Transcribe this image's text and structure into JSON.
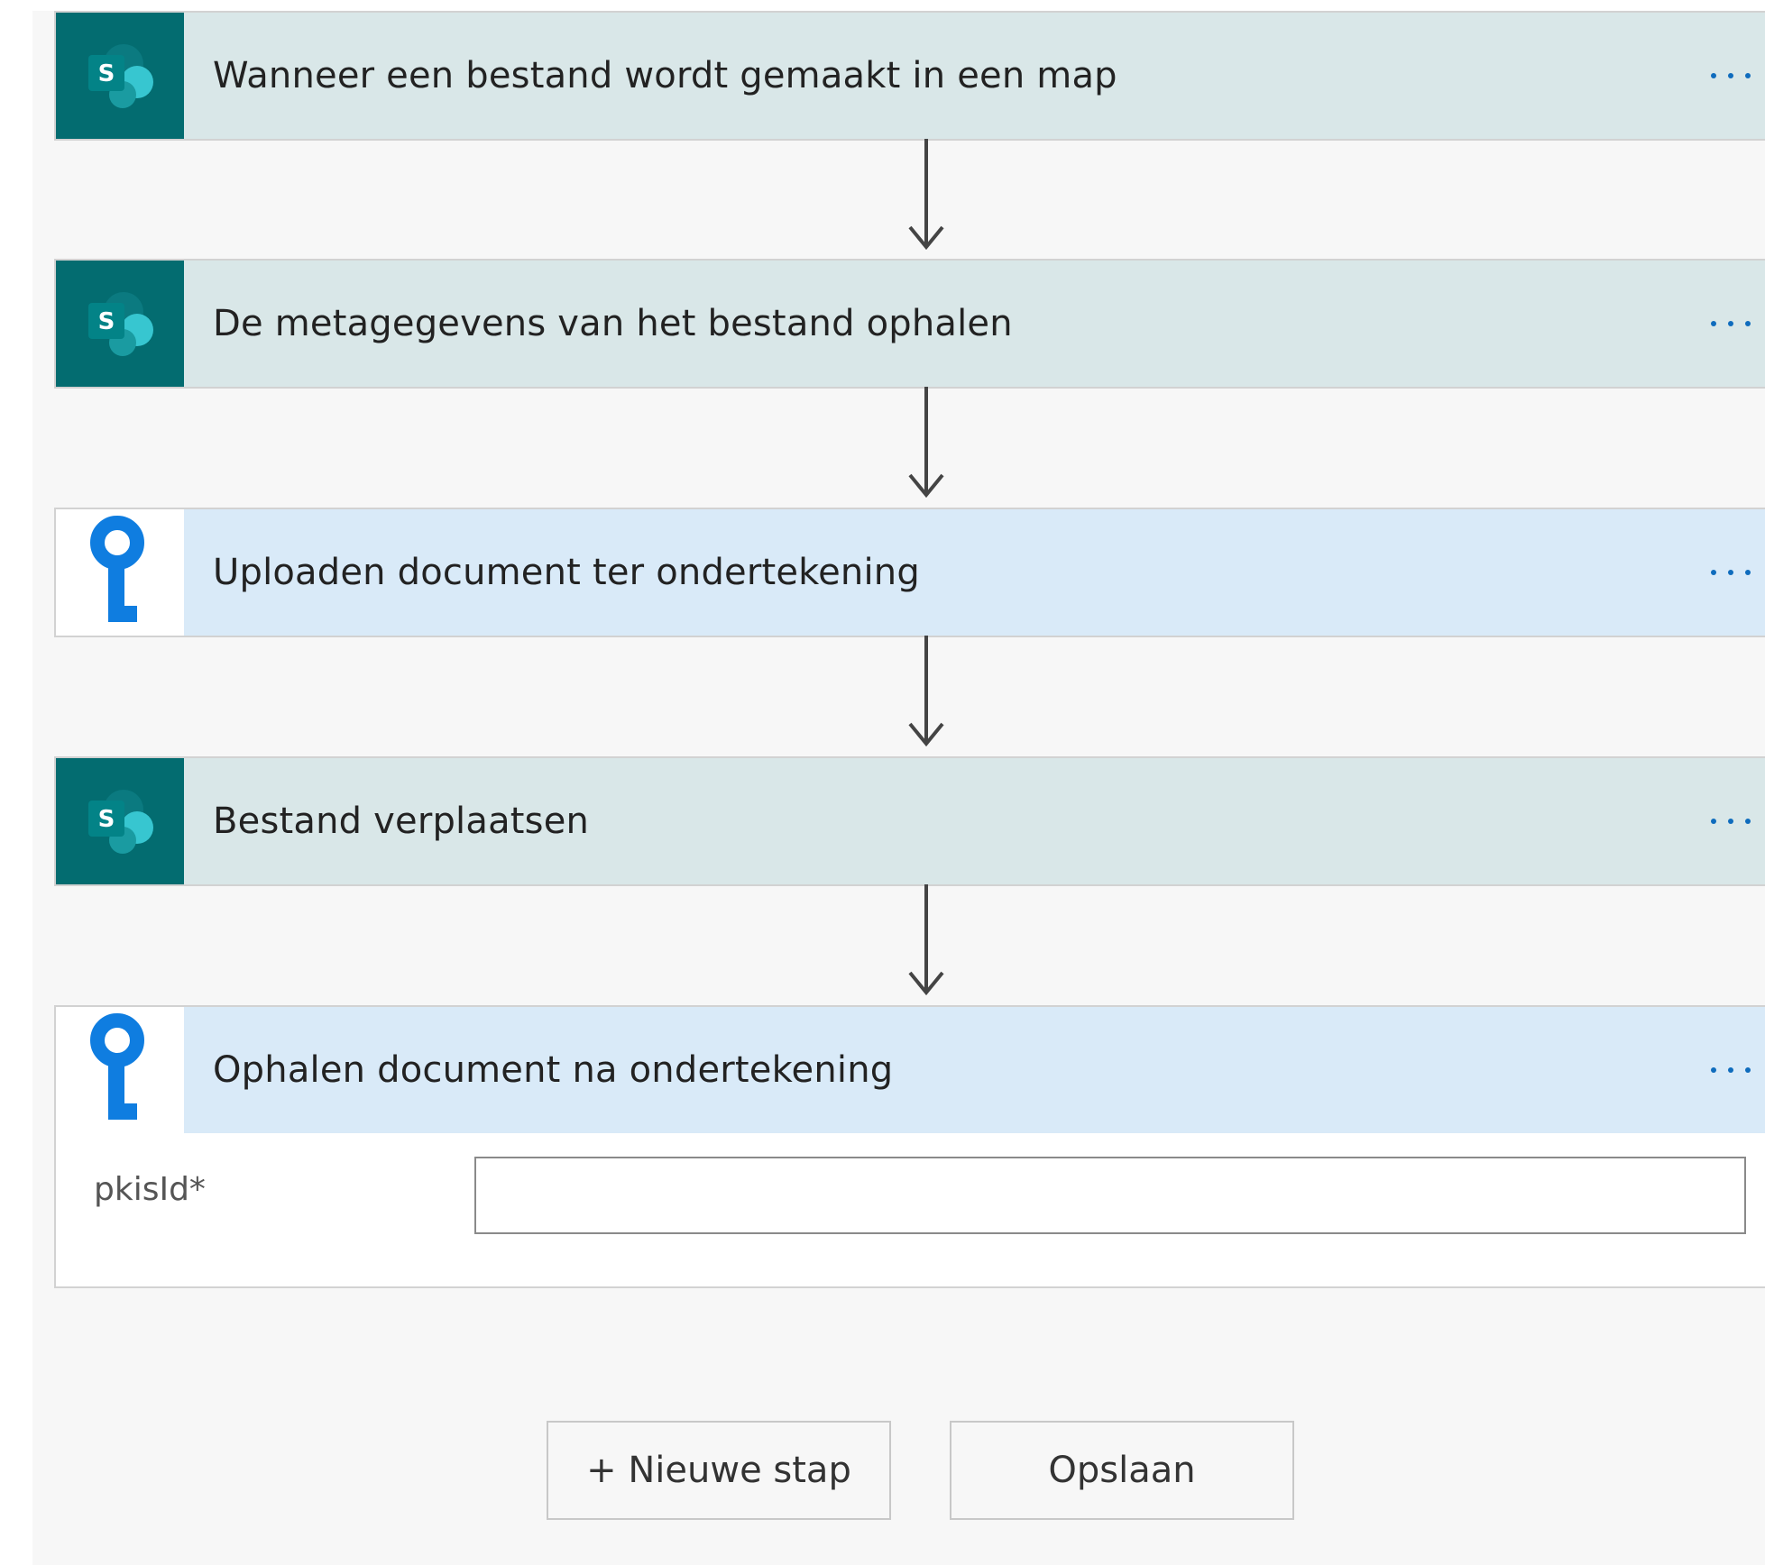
{
  "steps": [
    {
      "title": "Wanneer een bestand wordt gemaakt in een map",
      "icon": "sharepoint-icon",
      "header_color": "#d9e7e8"
    },
    {
      "title": "De metagegevens van het bestand ophalen",
      "icon": "sharepoint-icon",
      "header_color": "#d9e7e8"
    },
    {
      "title": "Uploaden document ter ondertekening",
      "icon": "key-icon",
      "header_color": "#d9eaf8"
    },
    {
      "title": "Bestand verplaatsen",
      "icon": "sharepoint-icon",
      "header_color": "#d9e7e8"
    },
    {
      "title": "Ophalen document na ondertekening",
      "icon": "key-icon",
      "header_color": "#d9eaf8"
    }
  ],
  "expanded_step": {
    "field_label": "pkisId*",
    "field_value": ""
  },
  "buttons": {
    "new_step": "+ Nieuwe stap",
    "save": "Opslaan"
  },
  "colors": {
    "sharepoint_teal": "#036c70",
    "key_blue": "#0f7de0",
    "dots_blue": "#0f6cbd"
  }
}
